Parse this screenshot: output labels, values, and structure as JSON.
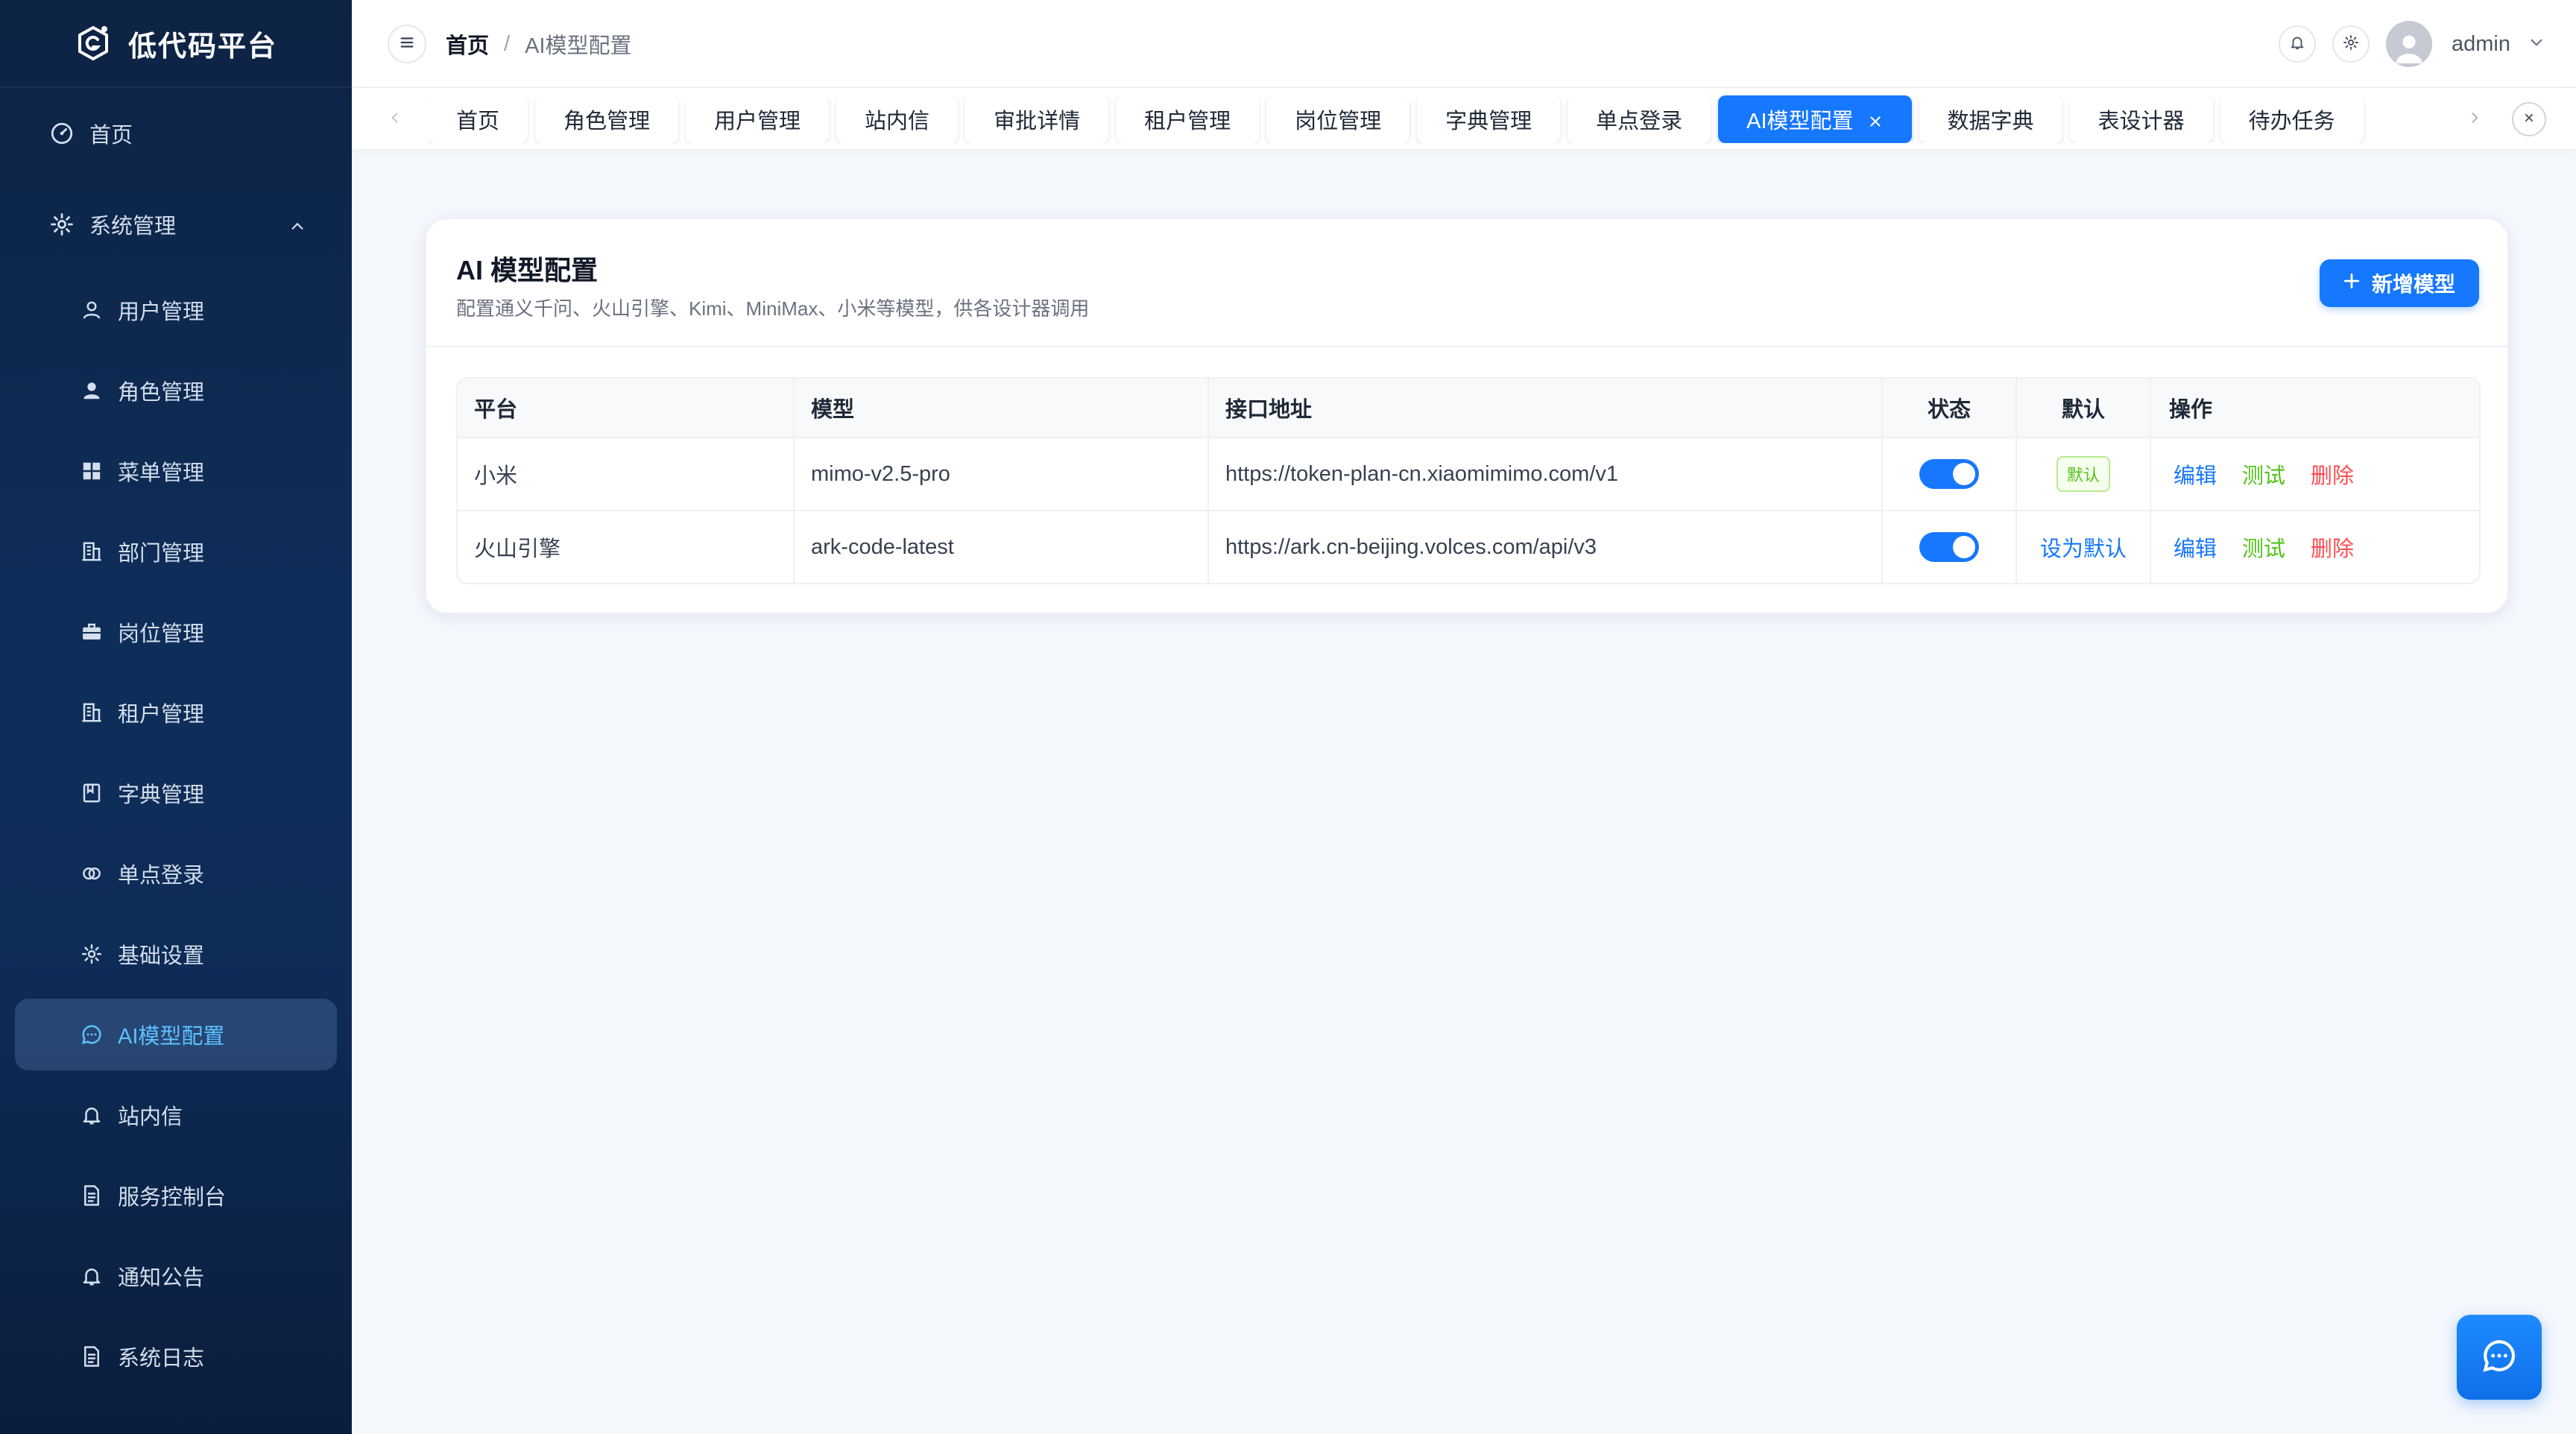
{
  "app": {
    "title": "低代码平台"
  },
  "sidebar": {
    "home": "首页",
    "system": "系统管理",
    "items": [
      {
        "label": "用户管理",
        "icon": "user-icon"
      },
      {
        "label": "角色管理",
        "icon": "user-solid-icon"
      },
      {
        "label": "菜单管理",
        "icon": "grid-icon"
      },
      {
        "label": "部门管理",
        "icon": "building-icon"
      },
      {
        "label": "岗位管理",
        "icon": "briefcase-icon"
      },
      {
        "label": "租户管理",
        "icon": "building-icon"
      },
      {
        "label": "字典管理",
        "icon": "book-icon"
      },
      {
        "label": "单点登录",
        "icon": "link-icon"
      },
      {
        "label": "基础设置",
        "icon": "gear-icon"
      },
      {
        "label": "AI模型配置",
        "icon": "chat-icon",
        "active": true
      },
      {
        "label": "站内信",
        "icon": "bell-icon"
      },
      {
        "label": "服务控制台",
        "icon": "document-icon"
      },
      {
        "label": "通知公告",
        "icon": "bell-icon"
      },
      {
        "label": "系统日志",
        "icon": "document-icon"
      }
    ]
  },
  "header": {
    "breadcrumb": {
      "home": "首页",
      "separator": "/",
      "current": "AI模型配置"
    },
    "user": "admin"
  },
  "tabs": [
    {
      "label": "首页"
    },
    {
      "label": "角色管理"
    },
    {
      "label": "用户管理"
    },
    {
      "label": "站内信"
    },
    {
      "label": "审批详情"
    },
    {
      "label": "租户管理"
    },
    {
      "label": "岗位管理"
    },
    {
      "label": "字典管理"
    },
    {
      "label": "单点登录"
    },
    {
      "label": "AI模型配置",
      "active": true
    },
    {
      "label": "数据字典"
    },
    {
      "label": "表设计器"
    },
    {
      "label": "待办任务"
    }
  ],
  "page": {
    "title": "AI 模型配置",
    "subtitle": "配置通义千问、火山引擎、Kimi、MiniMax、小米等模型，供各设计器调用",
    "add_button": "新增模型"
  },
  "table": {
    "columns": [
      "平台",
      "模型",
      "接口地址",
      "状态",
      "默认",
      "操作"
    ],
    "rows": [
      {
        "platform": "小米",
        "model": "mimo-v2.5-pro",
        "url": "https://token-plan-cn.xiaomimimo.com/v1",
        "enabled": true,
        "default_label": "默认",
        "is_default": true
      },
      {
        "platform": "火山引擎",
        "model": "ark-code-latest",
        "url": "https://ark.cn-beijing.volces.com/api/v3",
        "enabled": true,
        "default_label": "设为默认",
        "is_default": false
      }
    ],
    "actions": {
      "edit": "编辑",
      "test": "测试",
      "delete": "删除"
    }
  },
  "colors": {
    "primary": "#1677ff",
    "success": "#52c41a",
    "danger": "#ff4d4f",
    "sidebar": "#0e2e5a"
  }
}
